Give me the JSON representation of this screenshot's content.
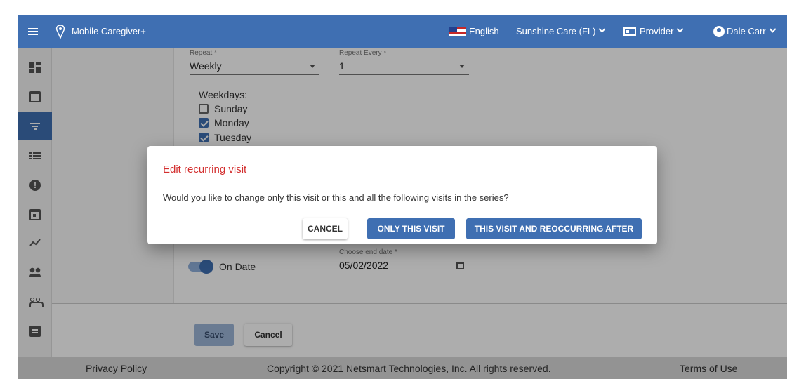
{
  "app": {
    "title": "Mobile Caregiver+",
    "language": "English",
    "organization": "Sunshine Care (FL)",
    "role": "Provider",
    "user": "Dale Carr",
    "accent_color": "#3f6fb2"
  },
  "sidebar": {
    "items": [
      {
        "icon": "dashboard-icon"
      },
      {
        "icon": "calendar-icon"
      },
      {
        "icon": "filter-icon",
        "active": true
      },
      {
        "icon": "list-icon"
      },
      {
        "icon": "alert-icon"
      },
      {
        "icon": "event-icon"
      },
      {
        "icon": "trending-icon"
      },
      {
        "icon": "people-icon"
      },
      {
        "icon": "group-icon"
      },
      {
        "icon": "clipboard-icon"
      }
    ]
  },
  "form": {
    "repeat_label": "Repeat *",
    "repeat_value": "Weekly",
    "repeat_every_label": "Repeat Every *",
    "repeat_every_value": "1",
    "weekdays_label": "Weekdays:",
    "weekdays": [
      {
        "label": "Sunday",
        "checked": false
      },
      {
        "label": "Monday",
        "checked": true
      },
      {
        "label": "Tuesday",
        "checked": true
      }
    ],
    "end_toggle_label": "On Date",
    "end_date_label": "Choose end date *",
    "end_date_value": "05/02/2022",
    "save_label": "Save",
    "cancel_label": "Cancel"
  },
  "dialog": {
    "title": "Edit recurring visit",
    "message": "Would you like to change only this visit or this and all the following visits in the series?",
    "cancel_label": "CANCEL",
    "only_this_label": "ONLY THIS VISIT",
    "all_following_label": "THIS VISIT AND REOCCURRING AFTER",
    "title_color": "#d32f2f"
  },
  "footer": {
    "privacy": "Privacy Policy",
    "copyright": "Copyright © 2021 Netsmart Technologies, Inc. All rights reserved.",
    "terms": "Terms of Use"
  }
}
